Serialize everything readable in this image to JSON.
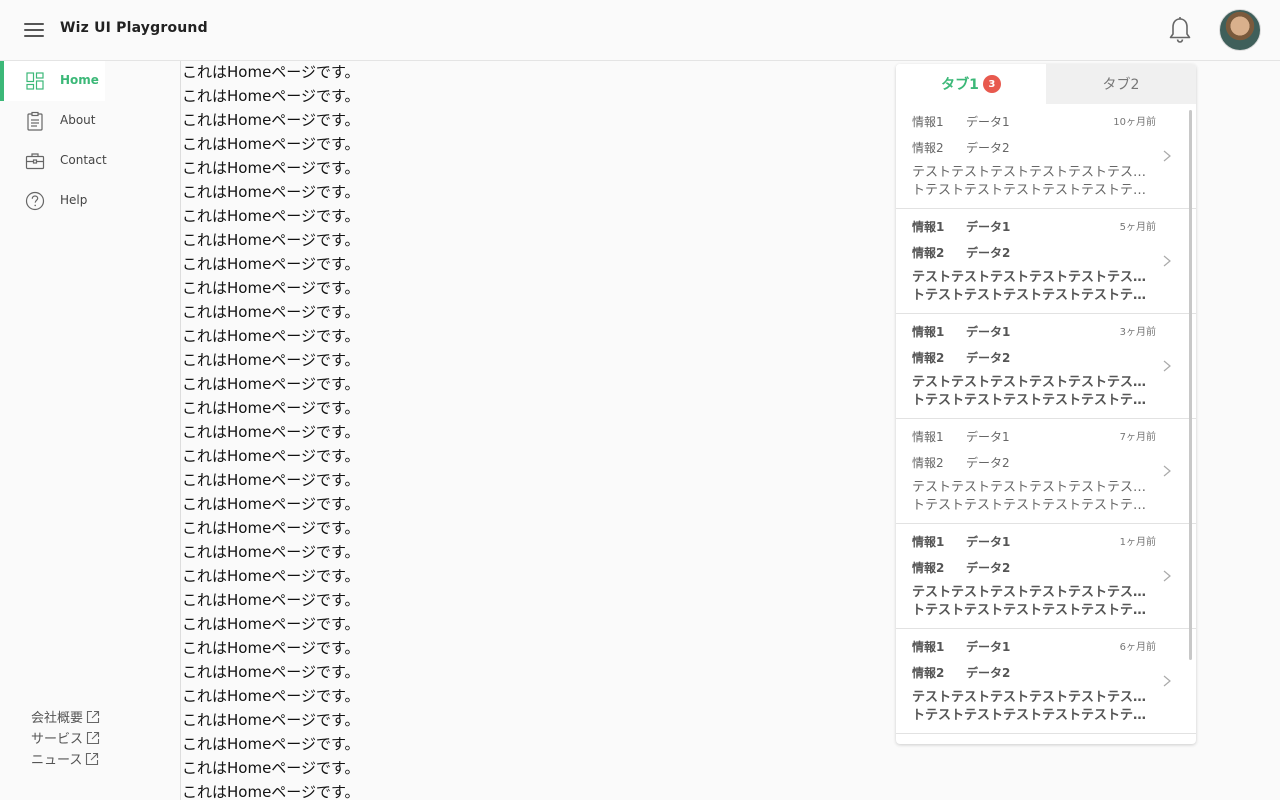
{
  "header": {
    "title": "Wiz UI Playground"
  },
  "sidebar": {
    "items": [
      {
        "label": "Home",
        "icon": "dashboard-icon",
        "active": true
      },
      {
        "label": "About",
        "icon": "clipboard-icon"
      },
      {
        "label": "Contact",
        "icon": "briefcase-icon"
      },
      {
        "label": "Help",
        "icon": "help-circle-icon"
      }
    ],
    "footer_links": [
      "会社概要",
      "サービス",
      "ニュース"
    ]
  },
  "main": {
    "line_text": "これはHomeページです。",
    "lines": [
      "これはHomeページです。",
      "これはHomeページです。",
      "これはHomeページです。",
      "これはHomeページです。",
      "これはHomeページです。",
      "これはHomeページです。",
      "これはHomeページです。",
      "これはHomeページです。",
      "これはHomeページです。",
      "これはHomeページです。",
      "これはHomeページです。",
      "これはHomeページです。",
      "これはHomeページです。",
      "これはHomeページです。",
      "これはHomeページです。",
      "これはHomeページです。",
      "これはHomeページです。",
      "これはHomeページです。",
      "これはHomeページです。",
      "これはHomeページです。",
      "これはHomeページです。",
      "これはHomeページです。",
      "これはHomeページです。",
      "これはHomeページです。",
      "これはHomeページです。",
      "これはHomeページです。",
      "これはHomeページです。",
      "これはHomeページです。",
      "これはHomeページです。",
      "これはHomeページです。",
      "これはHomeページです。"
    ]
  },
  "panel": {
    "tabs": [
      {
        "label": "タブ1",
        "badge": "3"
      },
      {
        "label": "タブ2"
      }
    ],
    "items": [
      {
        "k1": "情報1",
        "v1": "データ1",
        "k2": "情報2",
        "v2": "データ2",
        "time": "10ヶ月前",
        "line1": "テストテストテストテストテストテストテスト",
        "line2": "トテストテストテストテストテストテストテスト…",
        "unread": false
      },
      {
        "k1": "情報1",
        "v1": "データ1",
        "k2": "情報2",
        "v2": "データ2",
        "time": "5ヶ月前",
        "line1": "テストテストテストテストテストテストテスト",
        "line2": "トテストテストテストテストテストテストテスト…",
        "unread": true
      },
      {
        "k1": "情報1",
        "v1": "データ1",
        "k2": "情報2",
        "v2": "データ2",
        "time": "3ヶ月前",
        "line1": "テストテストテストテストテストテストテスト",
        "line2": "トテストテストテストテストテストテストテスト…",
        "unread": true
      },
      {
        "k1": "情報1",
        "v1": "データ1",
        "k2": "情報2",
        "v2": "データ2",
        "time": "7ヶ月前",
        "line1": "テストテストテストテストテストテストテスト",
        "line2": "トテストテストテストテストテストテストテスト…",
        "unread": false
      },
      {
        "k1": "情報1",
        "v1": "データ1",
        "k2": "情報2",
        "v2": "データ2",
        "time": "1ヶ月前",
        "line1": "テストテストテストテストテストテストテスト",
        "line2": "トテストテストテストテストテストテストテスト…",
        "unread": true
      },
      {
        "k1": "情報1",
        "v1": "データ1",
        "k2": "情報2",
        "v2": "データ2",
        "time": "6ヶ月前",
        "line1": "テストテストテストテストテストテストテスト",
        "line2": "トテストテストテストテストテストテストテスト…",
        "unread": true
      }
    ]
  },
  "colors": {
    "accent": "#3cb878",
    "badge": "#e8594e"
  }
}
